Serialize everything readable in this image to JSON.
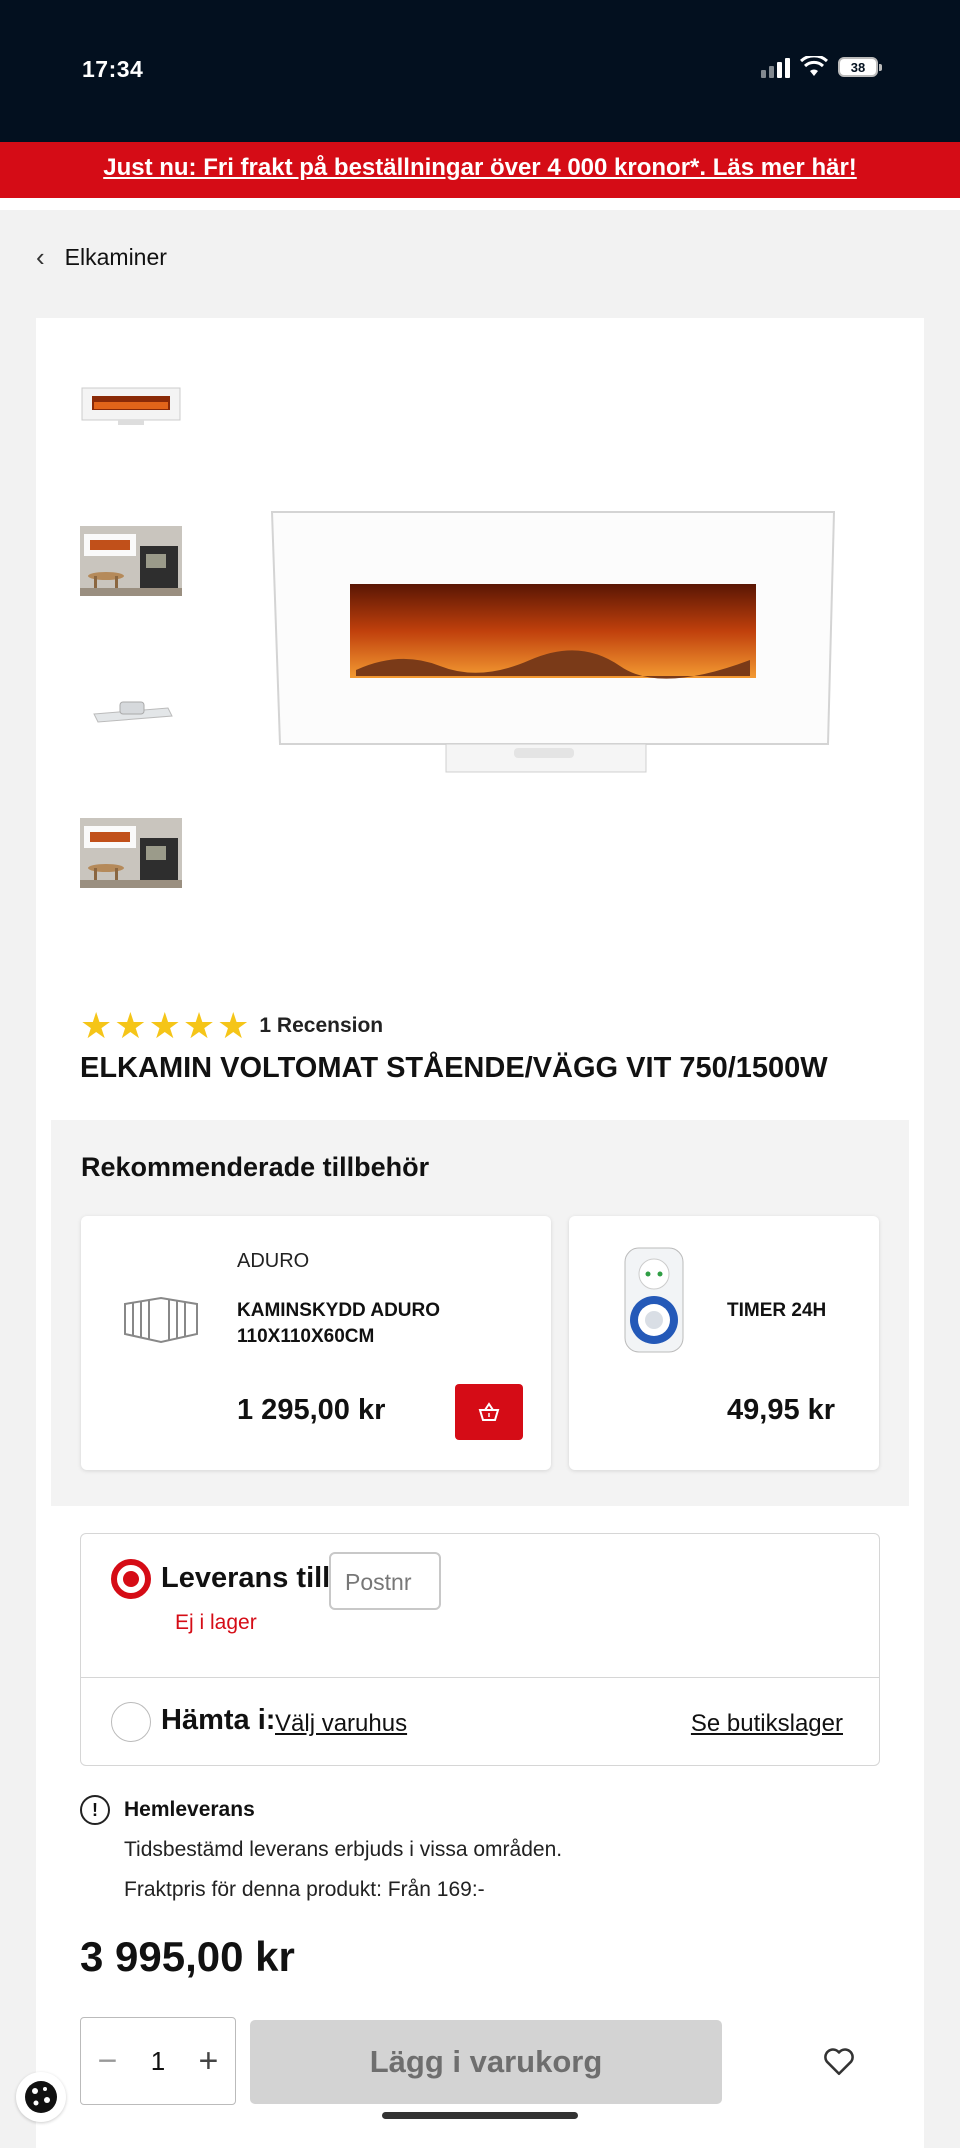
{
  "status_bar": {
    "time": "17:34",
    "battery": "38"
  },
  "promo": {
    "text": "Just nu: Fri frakt på beställningar över 4 000 kronor*. Läs mer här!"
  },
  "breadcrumb": {
    "label": "Elkaminer"
  },
  "product": {
    "review_count": "1 Recension",
    "rating": 5,
    "title": "ELKAMIN VOLTOMAT STÅENDE/VÄGG VIT 750/1500W",
    "price": "3 995,00 kr"
  },
  "recommended": {
    "heading": "Rekommenderade tillbehör",
    "items": [
      {
        "brand": "ADURO",
        "name": "KAMINSKYDD ADURO 110X110X60CM",
        "price": "1 295,00 kr"
      },
      {
        "brand": "",
        "name": "TIMER 24H",
        "price": "49,95 kr"
      }
    ]
  },
  "delivery": {
    "deliver_label": "Leverans till:",
    "postnr_placeholder": "Postnr",
    "stock_status": "Ej i lager",
    "pickup_label": "Hämta i:",
    "choose_store": "Välj varuhus",
    "store_stock": "Se butikslager"
  },
  "info": {
    "heading": "Hemleverans",
    "line1": "Tidsbestämd leverans erbjuds i vissa områden.",
    "line2": "Fraktpris för denna produkt: Från 169:-"
  },
  "purchase": {
    "quantity": "1",
    "add_to_cart": "Lägg i varukorg"
  },
  "colors": {
    "brand_red": "#d50c16",
    "status_bar_bg": "#03101f",
    "star": "#f5c518"
  }
}
